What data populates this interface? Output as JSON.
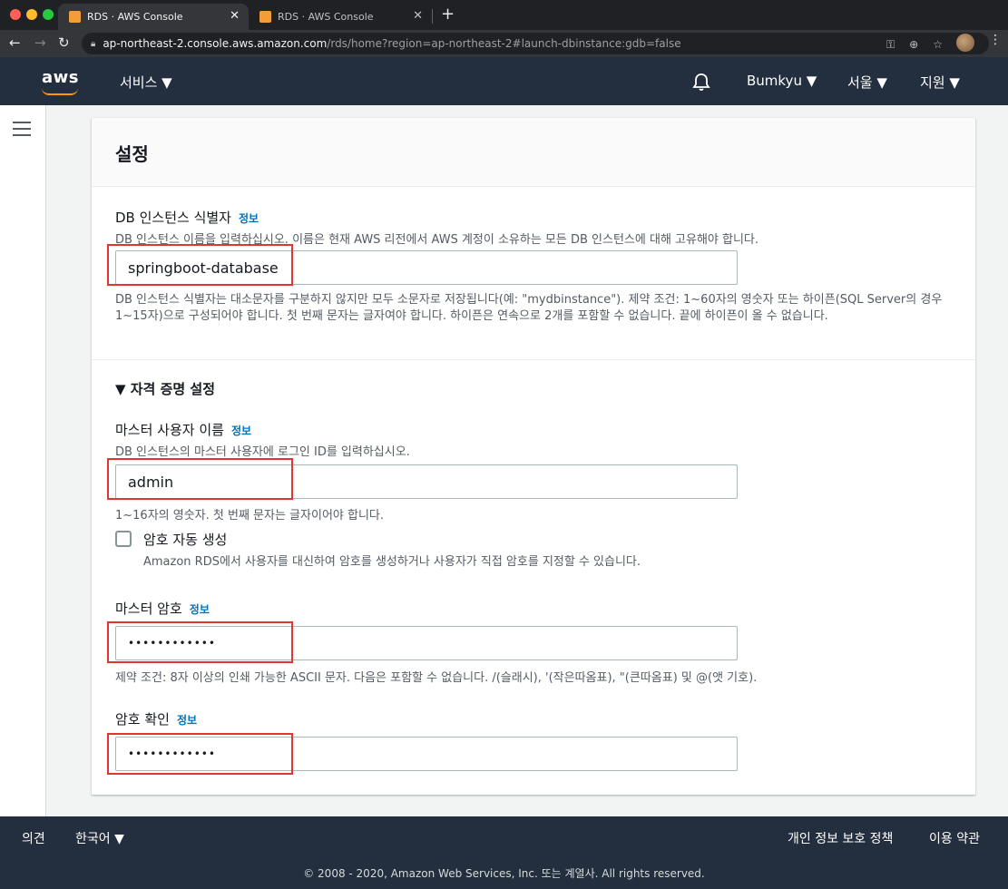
{
  "browser": {
    "tabs": [
      {
        "title": "RDS · AWS Console",
        "active": true
      },
      {
        "title": "RDS · AWS Console",
        "active": false
      }
    ],
    "url_host": "ap-northeast-2.console.aws.amazon.com",
    "url_path": "/rds/home?region=ap-northeast-2#launch-dbinstance:gdb=false"
  },
  "header": {
    "logo": "aws",
    "services_label": "서비스 ▼",
    "user_label": "Bumkyu ▼",
    "region_label": "서울 ▼",
    "support_label": "지원 ▼"
  },
  "settings": {
    "title": "설정",
    "info_label": "정보",
    "db_identifier": {
      "label": "DB 인스턴스 식별자",
      "description": "DB 인스턴스 이름을 입력하십시오. 이름은 현재 AWS 리전에서 AWS 계정이 소유하는 모든 DB 인스턴스에 대해 고유해야 합니다.",
      "value": "springboot-database",
      "constraint": "DB 인스턴스 식별자는 대소문자를 구분하지 않지만 모두 소문자로 저장됩니다(예: \"mydbinstance\"). 제약 조건: 1~60자의 영숫자 또는 하이픈(SQL Server의 경우 1~15자)으로 구성되어야 합니다. 첫 번째 문자는 글자여야 합니다. 하이픈은 연속으로 2개를 포함할 수 없습니다. 끝에 하이픈이 올 수 없습니다."
    },
    "credentials": {
      "section_title": "▼ 자격 증명 설정",
      "master_user": {
        "label": "마스터 사용자 이름",
        "description": "DB 인스턴스의 마스터 사용자에 로그인 ID를 입력하십시오.",
        "value": "admin",
        "constraint": "1~16자의 영숫자. 첫 번째 문자는 글자이어야 합니다."
      },
      "auto_password": {
        "label": "암호 자동 생성",
        "description": "Amazon RDS에서 사용자를 대신하여 암호를 생성하거나 사용자가 직접 암호를 지정할 수 있습니다.",
        "checked": false
      },
      "master_password": {
        "label": "마스터 암호",
        "value": "••••••••••••",
        "constraint": "제약 조건: 8자 이상의 인쇄 가능한 ASCII 문자. 다음은 포함할 수 없습니다. /(슬래시), '(작은따옴표), \"(큰따옴표) 및 @(앳 기호)."
      },
      "confirm_password": {
        "label": "암호 확인",
        "value": "••••••••••••"
      }
    }
  },
  "footer": {
    "feedback": "의견",
    "language": "한국어 ▼",
    "privacy": "개인 정보 보호 정책",
    "terms": "이용 약관",
    "copyright": "© 2008 - 2020, Amazon Web Services, Inc. 또는 계열사. All rights reserved."
  },
  "colors": {
    "aws_navy": "#232f3e",
    "aws_orange": "#ff9900",
    "info_link": "#0073bb",
    "highlight_red": "#e3342f"
  }
}
